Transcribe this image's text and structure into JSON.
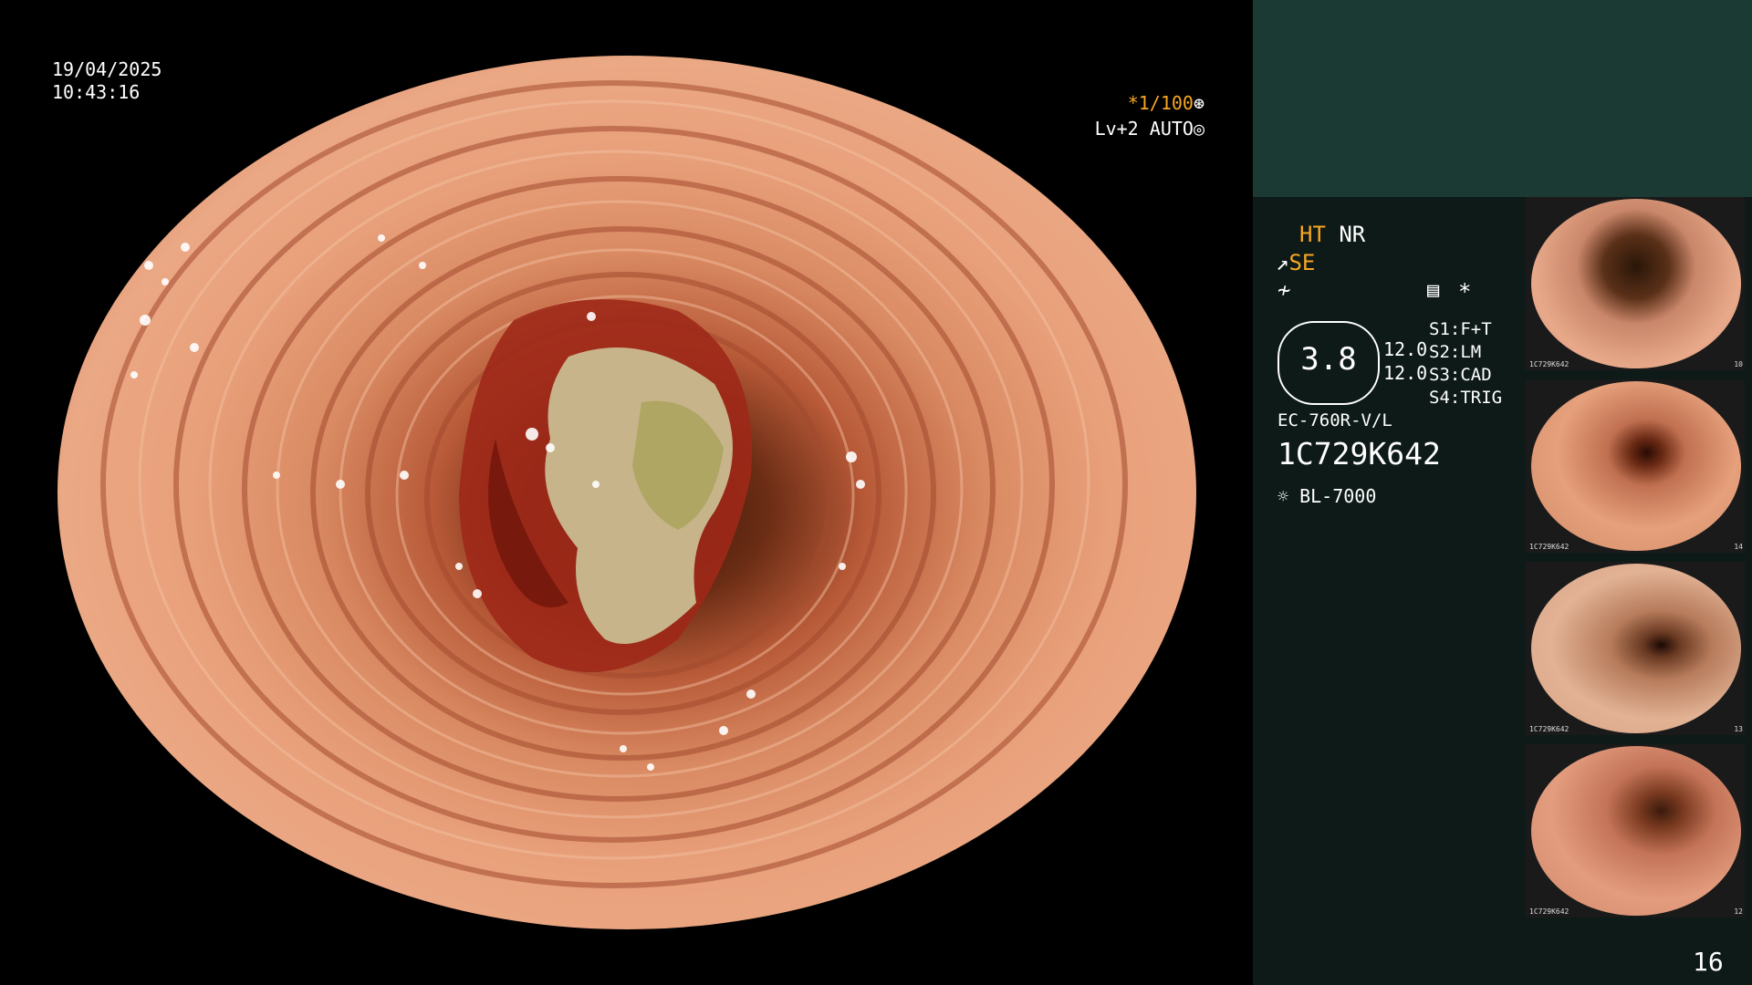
{
  "overlay": {
    "date": "19/04/2025",
    "time": "10:43:16",
    "shutter": "*1/100",
    "level": "Lv+2",
    "iris_mode": "AUTO"
  },
  "panel": {
    "mode_ht": "HT",
    "mode_nr": "NR",
    "mode_se": "SE",
    "gauge_value": "3.8",
    "value_a": "12.0",
    "value_b": "12.0",
    "switches": [
      {
        "key": "S1",
        "value": "F+T"
      },
      {
        "key": "S2",
        "value": "LM"
      },
      {
        "key": "S3",
        "value": "CAD"
      },
      {
        "key": "S4",
        "value": "TRIG"
      }
    ],
    "scope_model": "EC-760R-V/L",
    "scope_serial": "1C729K642",
    "light_source": "BL-7000",
    "asterisk": "*"
  },
  "thumbnails": [
    {
      "label": "1C729K642",
      "num": "10"
    },
    {
      "label": "1C729K642",
      "num": "14"
    },
    {
      "label": "1C729K642",
      "num": "13"
    },
    {
      "label": "1C729K642",
      "num": "12"
    }
  ],
  "page_number": "16",
  "colors": {
    "accent": "#f5a623",
    "panel_top": "#1c3a34",
    "panel_bg": "#0d1a17"
  }
}
